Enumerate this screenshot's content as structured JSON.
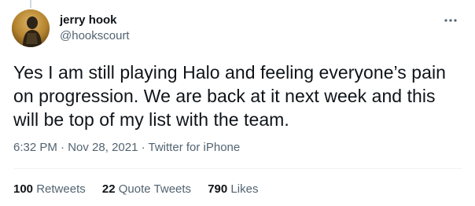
{
  "author": {
    "name": "jerry hook",
    "handle": "@hookscourt"
  },
  "tweet": {
    "text": "Yes I am still playing Halo and feeling everyone’s pain on progression. We are back at it next week and this will be top of my list with the team.",
    "time": "6:32 PM",
    "date": "Nov 28, 2021",
    "source": "Twitter for iPhone",
    "separator": " · "
  },
  "stats": {
    "retweets_count": "100",
    "retweets_label": "Retweets",
    "quotes_count": "22",
    "quotes_label": "Quote Tweets",
    "likes_count": "790",
    "likes_label": "Likes"
  },
  "icons": {
    "more": "more-dots-icon"
  },
  "colors": {
    "primary_text": "#0f1419",
    "secondary_text": "#536471",
    "divider": "#eff3f4"
  }
}
